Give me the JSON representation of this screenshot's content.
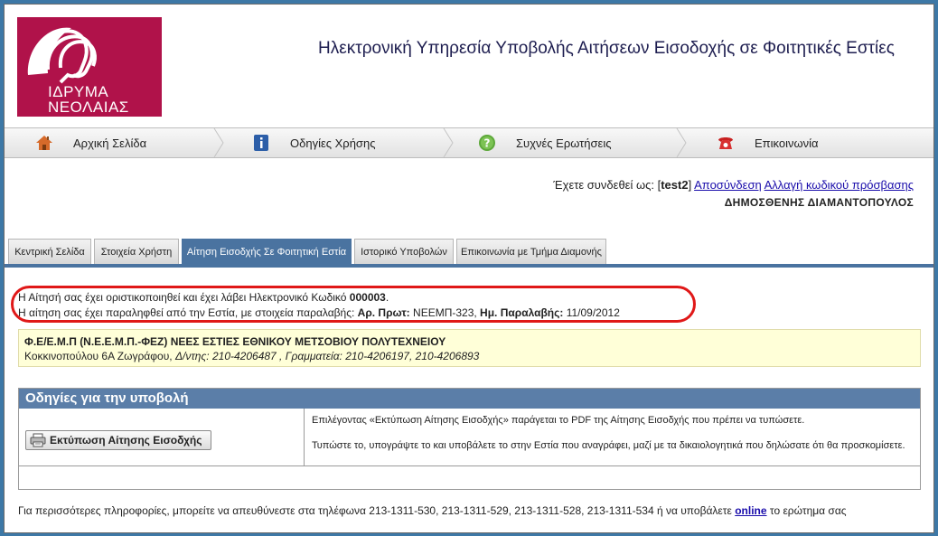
{
  "header": {
    "logo_text_1": "ΙΔΡΥΜΑ",
    "logo_text_2": "ΝΕΟΛΑΙΑΣ",
    "title": "Ηλεκτρονική Υπηρεσία Υποβολής Αιτήσεων Εισοδοχής σε Φοιτητικές Εστίες"
  },
  "nav": {
    "items": [
      {
        "label": "Αρχική Σελίδα",
        "icon": "home-icon"
      },
      {
        "label": "Οδηγίες Χρήσης",
        "icon": "info-icon"
      },
      {
        "label": "Συχνές Ερωτήσεις",
        "icon": "help-icon"
      },
      {
        "label": "Επικοινωνία",
        "icon": "phone-icon"
      }
    ]
  },
  "login": {
    "prefix": "Έχετε συνδεθεί ως: [",
    "username": "test2",
    "suffix": "]",
    "logout": "Αποσύνδεση",
    "change_password": "Αλλαγή κωδικού πρόσβασης",
    "full_name": "ΔΗΜΟΣΘΕΝΗΣ ΔΙΑΜΑΝΤΟΠΟΥΛΟΣ"
  },
  "tabs": [
    {
      "label": "Κεντρική Σελίδα"
    },
    {
      "label": "Στοιχεία Χρήστη"
    },
    {
      "label": "Αίτηση Εισοδχής Σε Φοιτητική Εστία"
    },
    {
      "label": "Ιστορικό Υποβολών"
    },
    {
      "label": "Επικοινωνία με Τμήμα Διαμονής"
    }
  ],
  "message": {
    "line1_text": "Η Αίτησή σας έχει οριστικοποιηθεί και έχει λάβει Ηλεκτρονικό Κωδικό ",
    "code": "000003",
    "line1_end": ".",
    "line2_text": "Η αίτηση σας έχει παραληφθεί από την Εστία, με στοιχεία παραλαβής: ",
    "protocol_label": "Αρ. Πρωτ:",
    "protocol_value": " ΝΕΕΜΠ-323, ",
    "date_label": "Ημ. Παραλαβής:",
    "date_value": " 11/09/2012"
  },
  "estia": {
    "title": "Φ.Ε/Ε.Μ.Π (Ν.Ε.Ε.Μ.Π.-ΦΕΖ) ΝΕΕΣ ΕΣΤΙΕΣ ΕΘΝΙΚΟΥ ΜΕΤΣΟΒΙΟΥ ΠΟΛΥΤΕΧΝΕΙΟΥ",
    "address": "Κοκκινοπούλου 6Α Ζωγράφου, ",
    "phones": "Δ/ντης: 210-4206487 , Γραμματεία: 210-4206197, 210-4206893"
  },
  "instructions": {
    "heading": "Οδηγίες για την υποβολή",
    "print_button": "Εκτύπωση Αίτησης Εισοδχής",
    "text1": "Επιλέγοντας «Εκτύπωση Αίτησης Εισοδχής» παράγεται το PDF της Αίτησης Εισοδχής που πρέπει να τυπώσετε.",
    "text2": "Τυπώστε το, υπογράψτε το και υποβάλετε το στην Εστία που αναγράφει, μαζί με τα δικαιολογητικά που δηλώσατε ότι θα προσκομίσετε."
  },
  "footer": {
    "text": "Για περισσότερες πληροφορίες, μπορείτε να απευθύνεστε στα τηλέφωνα 213-1311-530, 213-1311-529, 213-1311-528, 213-1311-534 ή να υποβάλετε ",
    "link": "online",
    "end": " το ερώτημα σας"
  },
  "colors": {
    "brand": "#b0124a",
    "tab_active": "#4a73a0",
    "highlight_oval": "#e01818"
  }
}
